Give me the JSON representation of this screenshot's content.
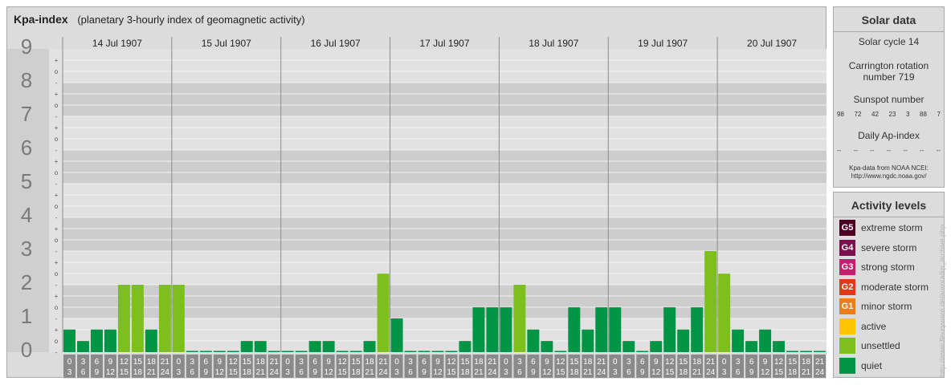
{
  "header": {
    "title": "Kpa-index",
    "subtitle": "(planetary 3-hourly index of geomagnetic activity)"
  },
  "chart_data": {
    "type": "bar",
    "y_axis": {
      "labels": [
        "0",
        "1",
        "2",
        "3",
        "4",
        "5",
        "6",
        "7",
        "8",
        "9"
      ],
      "ylim": [
        0,
        9
      ],
      "minor_labels": [
        "-",
        "o",
        "+"
      ]
    },
    "days": [
      "14 Jul 1907",
      "15 Jul 1907",
      "16 Jul 1907",
      "17 Jul 1907",
      "18 Jul 1907",
      "19 Jul 1907",
      "20 Jul 1907"
    ],
    "interval_top": [
      "0",
      "3",
      "6",
      "9",
      "12",
      "15",
      "18",
      "21"
    ],
    "interval_bottom": [
      "3",
      "6",
      "9",
      "12",
      "15",
      "18",
      "21",
      "24"
    ],
    "values": [
      0.67,
      0.33,
      0.67,
      0.67,
      2.0,
      2.0,
      0.67,
      2.0,
      2.0,
      0.0,
      0.0,
      0.0,
      0.0,
      0.33,
      0.33,
      0.0,
      0.0,
      0.0,
      0.33,
      0.33,
      0.0,
      0.0,
      0.33,
      2.33,
      1.0,
      0.0,
      0.0,
      0.0,
      0.0,
      0.33,
      1.33,
      1.33,
      1.33,
      2.0,
      0.67,
      0.33,
      0.0,
      1.33,
      0.67,
      1.33,
      1.33,
      0.33,
      0.0,
      0.33,
      1.33,
      0.67,
      1.33,
      3.0,
      2.33,
      0.67,
      0.33,
      0.67,
      0.33,
      0.0,
      0.0,
      0.0
    ],
    "colors": {
      "quiet": "#009445",
      "unsettled": "#7dc01e"
    },
    "grid": true
  },
  "solar": {
    "title": "Solar data",
    "cycle": "Solar cycle 14",
    "carrington_1": "Carrington rotation",
    "carrington_2": "number 719",
    "sunspot_title": "Sunspot number",
    "sunspots": [
      "98",
      "72",
      "42",
      "23",
      "3",
      "88",
      "7"
    ],
    "ap_title": "Daily Ap-index",
    "ap_values": [
      "--",
      "--",
      "--",
      "--",
      "--",
      "--",
      "--"
    ],
    "source_1": "Kpa-data from NOAA NCEI:",
    "source_2": "http://www.ngdc.noaa.gov/"
  },
  "legend": {
    "title": "Activity levels",
    "items": [
      {
        "code": "G5",
        "label": "extreme storm",
        "color": "#4e0024"
      },
      {
        "code": "G4",
        "label": "severe storm",
        "color": "#7c0f4e"
      },
      {
        "code": "G3",
        "label": "strong storm",
        "color": "#c41e6e"
      },
      {
        "code": "G2",
        "label": "moderate storm",
        "color": "#e03a1b"
      },
      {
        "code": "G1",
        "label": "minor storm",
        "color": "#eb7e19"
      },
      {
        "code": "",
        "label": "active",
        "color": "#ffc600"
      },
      {
        "code": "",
        "label": "unsettled",
        "color": "#7dc01e"
      },
      {
        "code": "",
        "label": "quiet",
        "color": "#009445"
      }
    ]
  },
  "credit": "http://www.fleuryware.de/aurora/kp_archive.php"
}
